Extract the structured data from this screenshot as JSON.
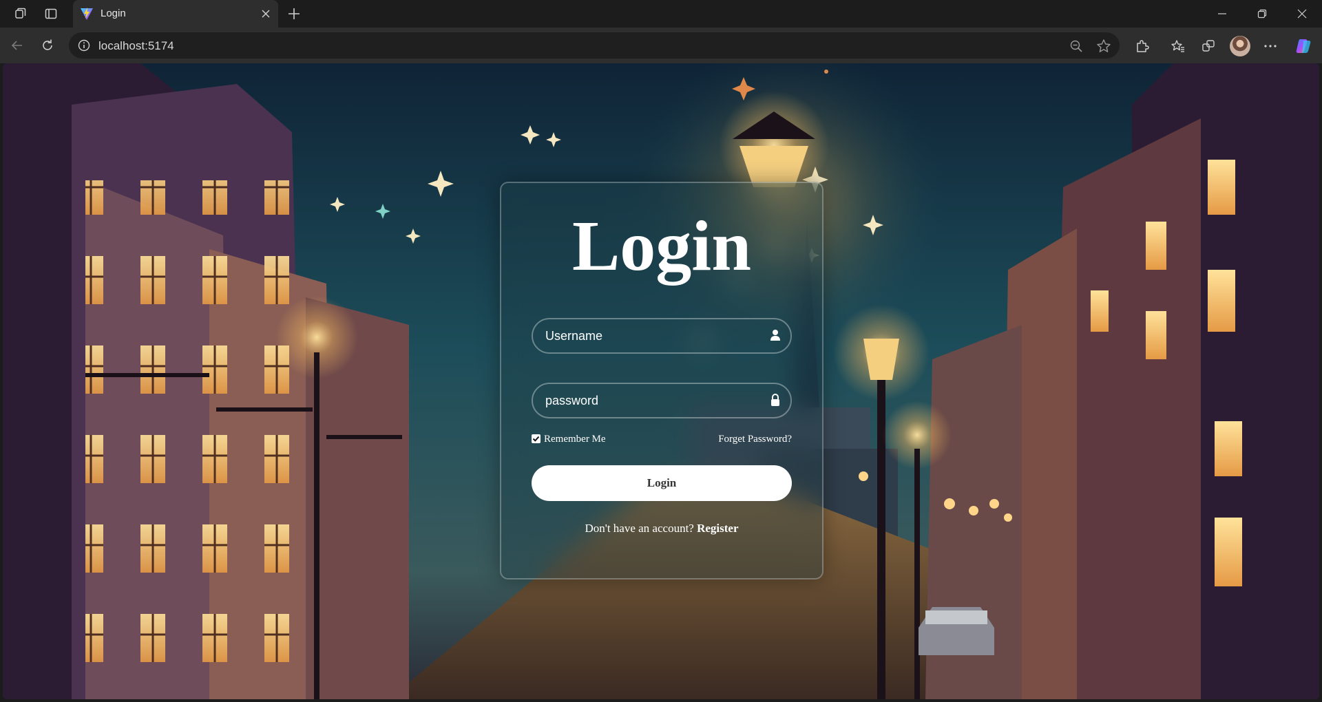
{
  "browser": {
    "tab_title": "Login",
    "address": "localhost:5174",
    "icons": {
      "workspaces": "workspaces-icon",
      "tab_actions": "vertical-tabs-icon",
      "favicon": "vite-logo-icon",
      "close_tab": "close-icon",
      "new_tab": "plus-icon",
      "minimize": "minimize-icon",
      "restore": "restore-icon",
      "close_window": "close-icon",
      "back": "back-arrow-icon",
      "refresh": "refresh-icon",
      "site_info": "info-icon",
      "zoom": "zoom-out-icon",
      "favorite": "star-icon",
      "extensions": "puzzle-icon",
      "favorites": "favorites-icon",
      "collections": "collections-icon",
      "profile": "avatar",
      "more": "more-icon",
      "copilot": "copilot-icon"
    }
  },
  "login": {
    "title": "Login",
    "username_placeholder": "Username",
    "password_placeholder": "password",
    "remember_label": "Remember Me",
    "remember_checked": true,
    "forgot_label": "Forget Password?",
    "submit_label": "Login",
    "register_prompt": "Don't have an account? ",
    "register_link": "Register"
  },
  "colors": {
    "card_border": "#ffffff",
    "button_bg": "#ffffff",
    "button_text": "#333333",
    "sky_top": "#0f2436",
    "sky_mid": "#1d4d5a"
  }
}
